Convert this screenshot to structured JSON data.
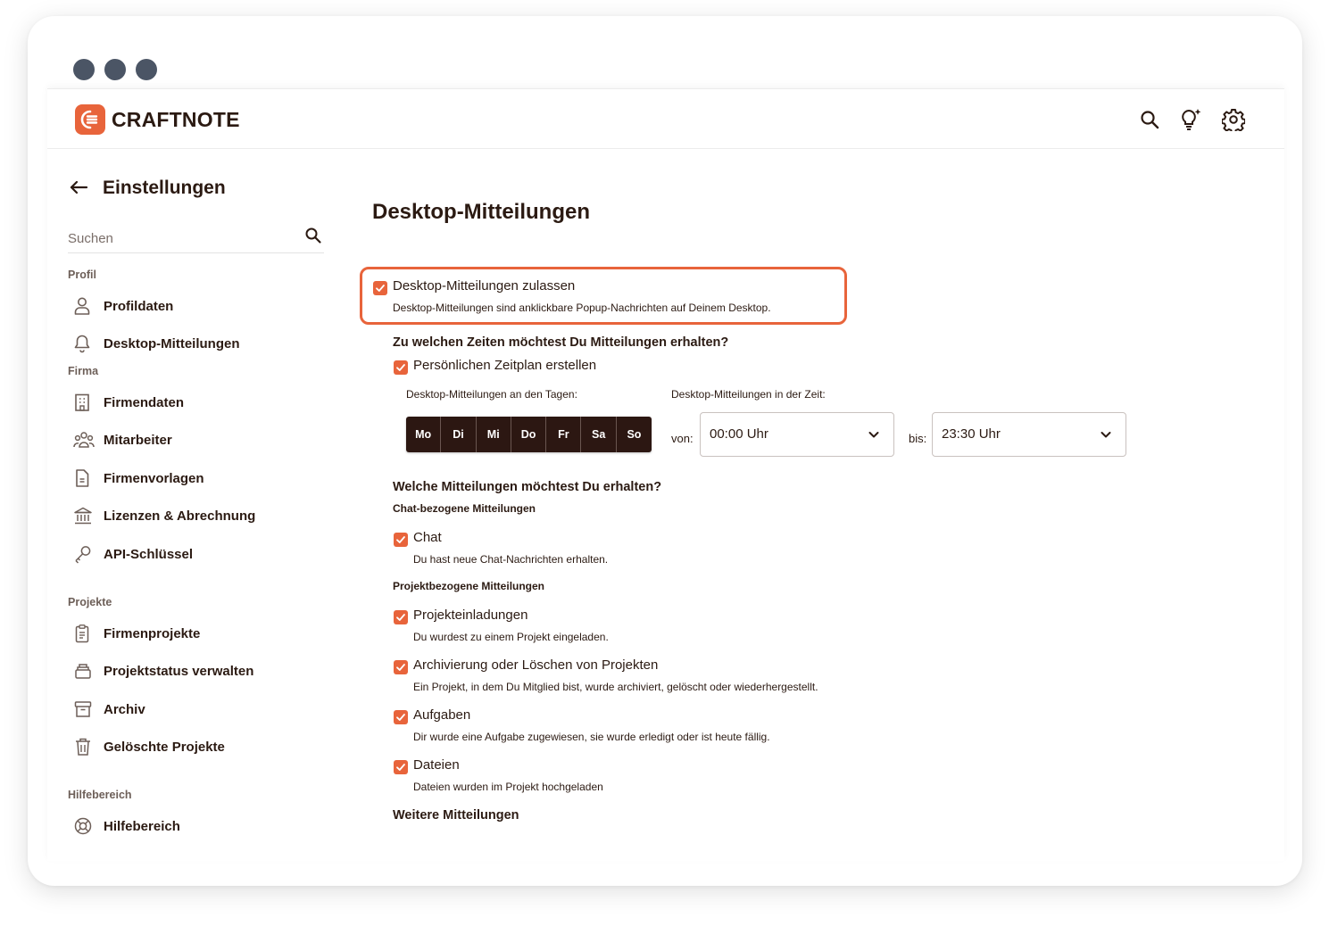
{
  "app": {
    "name": "CRAFTNOTE",
    "accent": "#e8643b",
    "dark": "#2c1712"
  },
  "header": {
    "icons": [
      "search-icon",
      "lightbulb-icon",
      "gear-icon"
    ]
  },
  "sidebar": {
    "title": "Einstellungen",
    "search_placeholder": "Suchen",
    "sections": {
      "profil": "Profil",
      "firma": "Firma",
      "projekte": "Projekte",
      "hilfe": "Hilfebereich"
    },
    "items": {
      "profildaten": "Profildaten",
      "desktop": "Desktop-Mitteilungen",
      "firmendaten": "Firmendaten",
      "mitarbeiter": "Mitarbeiter",
      "firmenvorlagen": "Firmenvorlagen",
      "lizenzen": "Lizenzen & Abrechnung",
      "api": "API-Schlüssel",
      "firmenprojekte": "Firmenprojekte",
      "projektstatus": "Projektstatus verwalten",
      "archiv": "Archiv",
      "geloeschte": "Gelöschte Projekte",
      "hilfebereich": "Hilfebereich"
    }
  },
  "main": {
    "title": "Desktop-Mitteilungen",
    "allow": {
      "label": "Desktop-Mitteilungen zulassen",
      "desc": "Desktop-Mitteilungen sind anklickbare Popup-Nachrichten auf Deinem Desktop.",
      "checked": true
    },
    "schedule": {
      "heading": "Zu welchen Zeiten möchtest Du Mitteilungen erhalten?",
      "personal_label": "Persönlichen Zeitplan erstellen",
      "personal_checked": true,
      "days_label": "Desktop-Mitteilungen an den Tagen:",
      "time_label": "Desktop-Mitteilungen in der Zeit:",
      "days": [
        "Mo",
        "Di",
        "Mi",
        "Do",
        "Fr",
        "Sa",
        "So"
      ],
      "from_label": "von:",
      "from_value": "00:00 Uhr",
      "to_label": "bis:",
      "to_value": "23:30 Uhr"
    },
    "which": {
      "heading": "Welche Mitteilungen möchtest Du erhalten?",
      "chat_sub": "Chat-bezogene Mitteilungen",
      "chat": {
        "label": "Chat",
        "desc": "Du hast neue Chat-Nachrichten erhalten.",
        "checked": true
      },
      "project_sub": "Projektbezogene Mitteilungen",
      "invites": {
        "label": "Projekteinladungen",
        "desc": "Du wurdest zu einem Projekt eingeladen.",
        "checked": true
      },
      "archive": {
        "label": "Archivierung oder Löschen von Projekten",
        "desc": "Ein Projekt, in dem Du Mitglied bist, wurde archiviert, gelöscht oder wiederhergestellt.",
        "checked": true
      },
      "tasks": {
        "label": "Aufgaben",
        "desc": "Dir wurde eine Aufgabe zugewiesen, sie wurde erledigt oder ist heute fällig.",
        "checked": true
      },
      "files": {
        "label": "Dateien",
        "desc": "Dateien wurden im Projekt hochgeladen",
        "checked": true
      },
      "more": "Weitere Mitteilungen"
    }
  }
}
